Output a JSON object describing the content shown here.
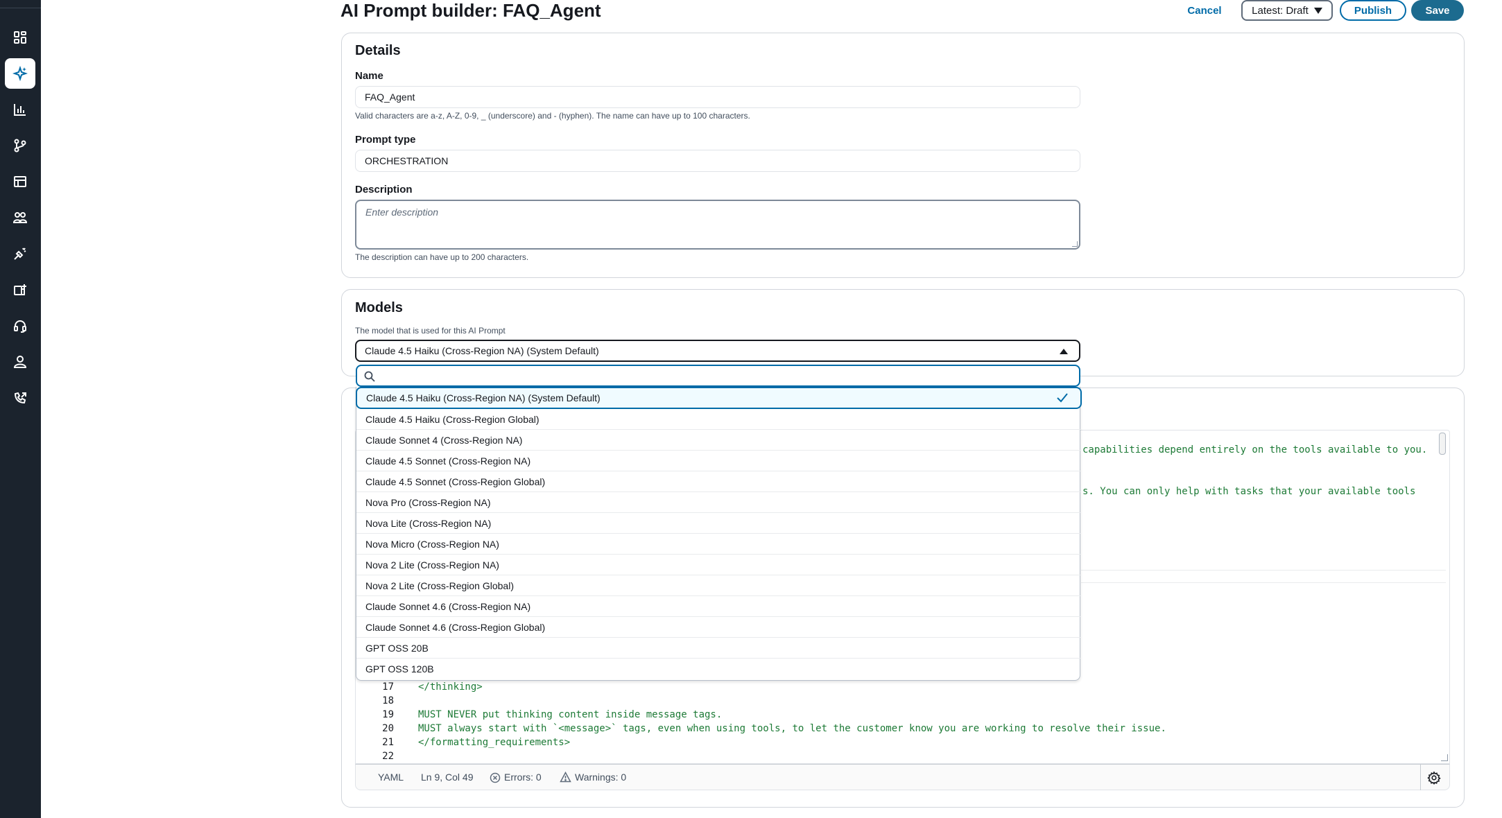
{
  "header": {
    "title": "AI Prompt builder: FAQ_Agent",
    "cancel": "Cancel",
    "version_select": "Latest: Draft",
    "publish": "Publish",
    "save": "Save"
  },
  "details": {
    "heading": "Details",
    "name_label": "Name",
    "name_value": "FAQ_Agent",
    "name_hint": "Valid characters are a-z, A-Z, 0-9, _ (underscore) and - (hyphen). The name can have up to 100 characters.",
    "prompt_type_label": "Prompt type",
    "prompt_type_value": "ORCHESTRATION",
    "description_label": "Description",
    "description_placeholder": "Enter description",
    "description_hint": "The description can have up to 200 characters."
  },
  "models": {
    "heading": "Models",
    "hint": "The model that is used for this AI Prompt",
    "selected": "Claude 4.5 Haiku (Cross-Region NA) (System Default)",
    "options": [
      "Claude 4.5 Haiku (Cross-Region NA) (System Default)",
      "Claude 4.5 Haiku (Cross-Region Global)",
      "Claude Sonnet 4 (Cross-Region NA)",
      "Claude 4.5 Sonnet (Cross-Region NA)",
      "Claude 4.5 Sonnet (Cross-Region Global)",
      "Nova Pro (Cross-Region NA)",
      "Nova Lite (Cross-Region NA)",
      "Nova Micro (Cross-Region NA)",
      "Nova 2 Lite (Cross-Region NA)",
      "Nova 2 Lite (Cross-Region Global)",
      "Claude Sonnet 4.6 (Cross-Region NA)",
      "Claude Sonnet 4.6 (Cross-Region Global)",
      "GPT OSS 20B",
      "GPT OSS 120B"
    ]
  },
  "editor": {
    "partial_lines": [
      "capabilities depend entirely on the tools available to you.",
      "s. You can only help with tasks that your available tools"
    ],
    "lines": [
      {
        "n": "17",
        "text": "</thinking>"
      },
      {
        "n": "18",
        "text": ""
      },
      {
        "n": "19",
        "text": "MUST NEVER put thinking content inside message tags."
      },
      {
        "n": "20",
        "text": "MUST always start with `<message>` tags, even when using tools, to let the customer know you are working to resolve their issue."
      },
      {
        "n": "21",
        "text": "</formatting_requirements>"
      },
      {
        "n": "22",
        "text": ""
      }
    ],
    "status": {
      "language": "YAML",
      "position": "Ln 9, Col 49",
      "errors": "Errors: 0",
      "warnings": "Warnings: 0"
    }
  },
  "sidebar": {
    "icons": [
      "dashboard-icon",
      "ai-sparkle-icon",
      "bar-chart-icon",
      "flow-branch-icon",
      "table-layout-icon",
      "users-group-icon",
      "rules-icon",
      "queue-add-icon",
      "headset-icon",
      "user-icon",
      "phone-routing-icon"
    ]
  }
}
